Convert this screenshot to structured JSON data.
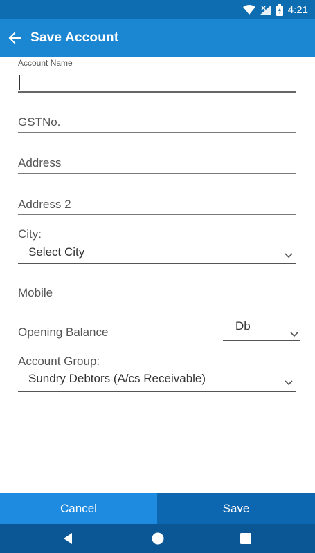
{
  "status_bar": {
    "time": "4:21",
    "icons": [
      "wifi-icon",
      "signal-icon",
      "battery-icon"
    ]
  },
  "app_bar": {
    "back_icon": "arrow-left-icon",
    "title": "Save Account"
  },
  "form": {
    "account_name": {
      "label": "Account Name",
      "value": ""
    },
    "gst_no": {
      "placeholder": "GSTNo."
    },
    "address": {
      "placeholder": "Address"
    },
    "address2": {
      "placeholder": "Address 2"
    },
    "city": {
      "label": "City:",
      "selected": "Select City"
    },
    "mobile": {
      "placeholder": "Mobile"
    },
    "opening_balance": {
      "placeholder": "Opening Balance",
      "type_selected": "Db"
    },
    "account_group": {
      "label": "Account Group:",
      "selected": "Sundry Debtors (A/cs Receivable)"
    }
  },
  "actions": {
    "cancel_label": "Cancel",
    "save_label": "Save"
  },
  "nav": {
    "icons": [
      "back-triangle-icon",
      "home-circle-icon",
      "recents-square-icon"
    ]
  },
  "colors": {
    "status_bar": "#0e6cb0",
    "app_bar": "#1b86d1",
    "cancel": "#1e8be0",
    "save": "#0d66b0",
    "nav_bar": "#0b5796"
  }
}
